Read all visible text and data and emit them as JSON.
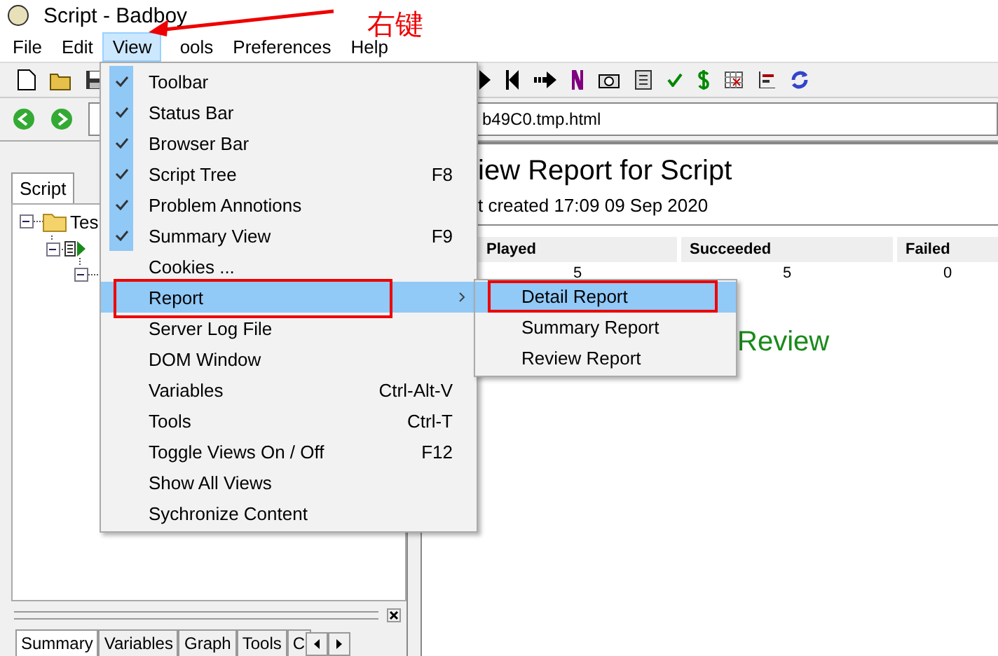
{
  "window": {
    "title": "Script - Badboy"
  },
  "menu_bar": [
    {
      "label": "File",
      "selected": false
    },
    {
      "label": "Edit",
      "selected": false
    },
    {
      "label": "View",
      "selected": true
    },
    {
      "label": "ools",
      "selected": false
    },
    {
      "label": "Preferences",
      "selected": false
    },
    {
      "label": "Help",
      "selected": false
    }
  ],
  "address_bar": {
    "value": "b49C0.tmp.html"
  },
  "script_panel": {
    "tabs": [
      {
        "label": "Script",
        "selected": true
      }
    ],
    "tree_root": {
      "label": "Tes",
      "expanded": true
    }
  },
  "bottom_tabs": [
    {
      "label": "Summary",
      "selected": true
    },
    {
      "label": "Variables",
      "selected": false
    },
    {
      "label": "Graph",
      "selected": false
    },
    {
      "label": "Tools",
      "selected": false
    },
    {
      "label": "C",
      "selected": false
    }
  ],
  "report": {
    "title": "iew Report for Script",
    "subtitle": "t created 17:09 09 Sep 2020",
    "columns": [
      "Played",
      "Succeeded",
      "Failed"
    ],
    "values": [
      "5",
      "5",
      "0"
    ],
    "section": "Review"
  },
  "view_menu": [
    {
      "label": "Toolbar",
      "checked": true,
      "selected": false
    },
    {
      "label": "Status Bar",
      "checked": true,
      "selected": false
    },
    {
      "label": "Browser Bar",
      "checked": true,
      "selected": false
    },
    {
      "label": "Script Tree",
      "checked": true,
      "shortcut": "F8",
      "selected": false
    },
    {
      "label": "Problem Annotions",
      "checked": true,
      "selected": false
    },
    {
      "label": "Summary View",
      "checked": true,
      "shortcut": "F9",
      "selected": false
    },
    {
      "label": "Cookies ...",
      "checked": false,
      "selected": false
    },
    {
      "label": "Report",
      "checked": false,
      "submenu": true,
      "selected": true
    },
    {
      "label": "Server Log File",
      "checked": false,
      "selected": false
    },
    {
      "label": "DOM Window",
      "checked": false,
      "selected": false
    },
    {
      "label": "Variables",
      "checked": false,
      "shortcut": "Ctrl-Alt-V",
      "selected": false
    },
    {
      "label": "Tools",
      "checked": false,
      "shortcut": "Ctrl-T",
      "selected": false
    },
    {
      "label": "Toggle Views On / Off",
      "checked": false,
      "shortcut": "F12",
      "selected": false
    },
    {
      "label": "Show All Views",
      "checked": false,
      "selected": false
    },
    {
      "label": "Sychronize Content",
      "checked": false,
      "selected": false
    }
  ],
  "submenu": [
    {
      "label": "Detail Report",
      "selected": true
    },
    {
      "label": "Summary Report",
      "selected": false
    },
    {
      "label": "Review Report",
      "selected": false
    }
  ],
  "annotation": {
    "text": "右键"
  }
}
